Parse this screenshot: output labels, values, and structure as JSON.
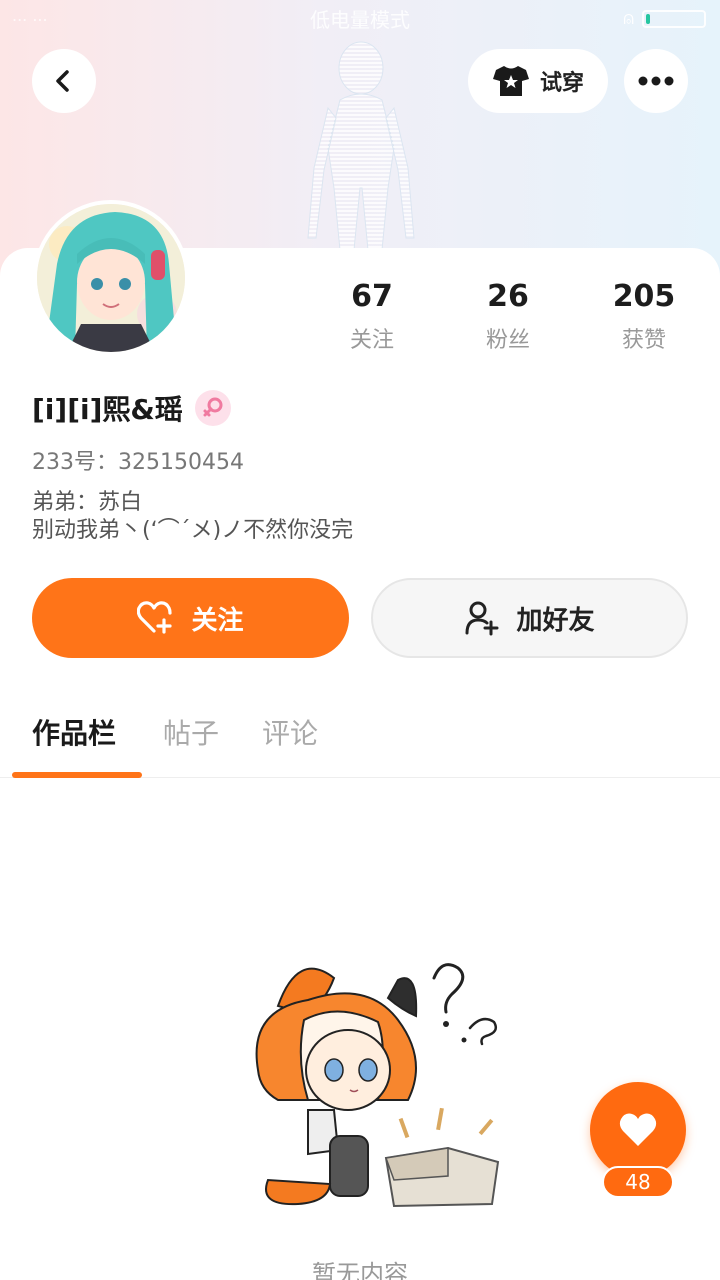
{
  "status_bar": {
    "title": "低电量模式",
    "left_text": "... ..."
  },
  "header": {
    "tryon_label": "试穿"
  },
  "profile": {
    "name": "[i][i]熙&瑶",
    "uid": "233号：325150454",
    "bio_line1": "弟弟：苏白",
    "bio_line2": "别动我弟丶(ʻ⌒ˊメ)ノ不然你没完"
  },
  "stats": [
    {
      "value": "67",
      "label": "关注"
    },
    {
      "value": "26",
      "label": "粉丝"
    },
    {
      "value": "205",
      "label": "获赞"
    }
  ],
  "actions": {
    "follow_label": "关注",
    "add_friend_label": "加好友"
  },
  "tabs": [
    {
      "label": "作品栏",
      "active": true
    },
    {
      "label": "帖子",
      "active": false
    },
    {
      "label": "评论",
      "active": false
    }
  ],
  "empty": {
    "text": "暂无内容"
  },
  "like": {
    "count": "48"
  },
  "colors": {
    "accent": "#ff7418",
    "gender_female": "#f07aa0"
  },
  "battery_level": 0.08
}
